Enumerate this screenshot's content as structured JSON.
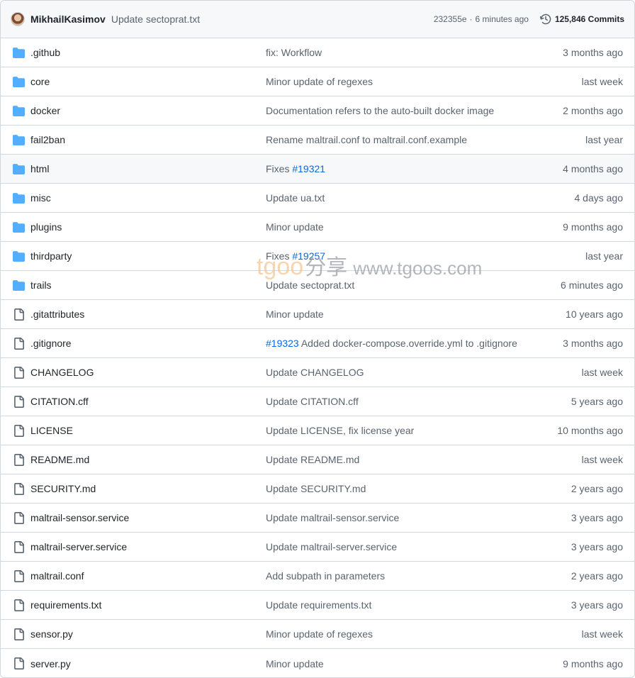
{
  "header": {
    "author": "MikhailKasimov",
    "message": "Update sectoprat.txt",
    "hash": "232355e",
    "separator": "·",
    "time": "6 minutes ago",
    "commits_label": "125,846 Commits"
  },
  "rows": [
    {
      "type": "folder",
      "name": ".github",
      "msg": "fix: Workflow",
      "link": "",
      "time": "3 months ago"
    },
    {
      "type": "folder",
      "name": "core",
      "msg": "Minor update of regexes",
      "link": "",
      "time": "last week"
    },
    {
      "type": "folder",
      "name": "docker",
      "msg": "Documentation refers to the auto-built docker image",
      "link": "",
      "time": "2 months ago"
    },
    {
      "type": "folder",
      "name": "fail2ban",
      "msg": "Rename maltrail.conf to maltrail.conf.example",
      "link": "",
      "time": "last year"
    },
    {
      "type": "folder",
      "name": "html",
      "msg": "Fixes ",
      "link": "#19321",
      "time": "4 months ago",
      "hover": true
    },
    {
      "type": "folder",
      "name": "misc",
      "msg": "Update ua.txt",
      "link": "",
      "time": "4 days ago"
    },
    {
      "type": "folder",
      "name": "plugins",
      "msg": "Minor update",
      "link": "",
      "time": "9 months ago"
    },
    {
      "type": "folder",
      "name": "thirdparty",
      "msg": "Fixes ",
      "link": "#19257",
      "time": "last year"
    },
    {
      "type": "folder",
      "name": "trails",
      "msg": "Update sectoprat.txt",
      "link": "",
      "time": "6 minutes ago"
    },
    {
      "type": "file",
      "name": ".gitattributes",
      "msg": "Minor update",
      "link": "",
      "time": "10 years ago"
    },
    {
      "type": "file",
      "name": ".gitignore",
      "msg": " Added docker-compose.override.yml to .gitignore",
      "link": "#19323",
      "linkFirst": true,
      "time": "3 months ago"
    },
    {
      "type": "file",
      "name": "CHANGELOG",
      "msg": "Update CHANGELOG",
      "link": "",
      "time": "last week"
    },
    {
      "type": "file",
      "name": "CITATION.cff",
      "msg": "Update CITATION.cff",
      "link": "",
      "time": "5 years ago"
    },
    {
      "type": "file",
      "name": "LICENSE",
      "msg": "Update LICENSE, fix license year",
      "link": "",
      "time": "10 months ago"
    },
    {
      "type": "file",
      "name": "README.md",
      "msg": "Update README.md",
      "link": "",
      "time": "last week"
    },
    {
      "type": "file",
      "name": "SECURITY.md",
      "msg": "Update SECURITY.md",
      "link": "",
      "time": "2 years ago"
    },
    {
      "type": "file",
      "name": "maltrail-sensor.service",
      "msg": "Update maltrail-sensor.service",
      "link": "",
      "time": "3 years ago"
    },
    {
      "type": "file",
      "name": "maltrail-server.service",
      "msg": "Update maltrail-server.service",
      "link": "",
      "time": "3 years ago"
    },
    {
      "type": "file",
      "name": "maltrail.conf",
      "msg": "Add subpath in parameters",
      "link": "",
      "time": "2 years ago"
    },
    {
      "type": "file",
      "name": "requirements.txt",
      "msg": "Update requirements.txt",
      "link": "",
      "time": "3 years ago"
    },
    {
      "type": "file",
      "name": "sensor.py",
      "msg": "Minor update of regexes",
      "link": "",
      "time": "last week"
    },
    {
      "type": "file",
      "name": "server.py",
      "msg": "Minor update",
      "link": "",
      "time": "9 months ago"
    }
  ],
  "icons": {
    "folder": "folder-icon",
    "file": "file-icon",
    "history": "history-icon"
  },
  "colors": {
    "folder": "#54aeff",
    "file": "#59636e",
    "link": "#0969da",
    "border": "#d0d7de"
  },
  "watermark": {
    "part1": "tgoo",
    "part2": "分享",
    "part3": "www.tgoos.com"
  }
}
